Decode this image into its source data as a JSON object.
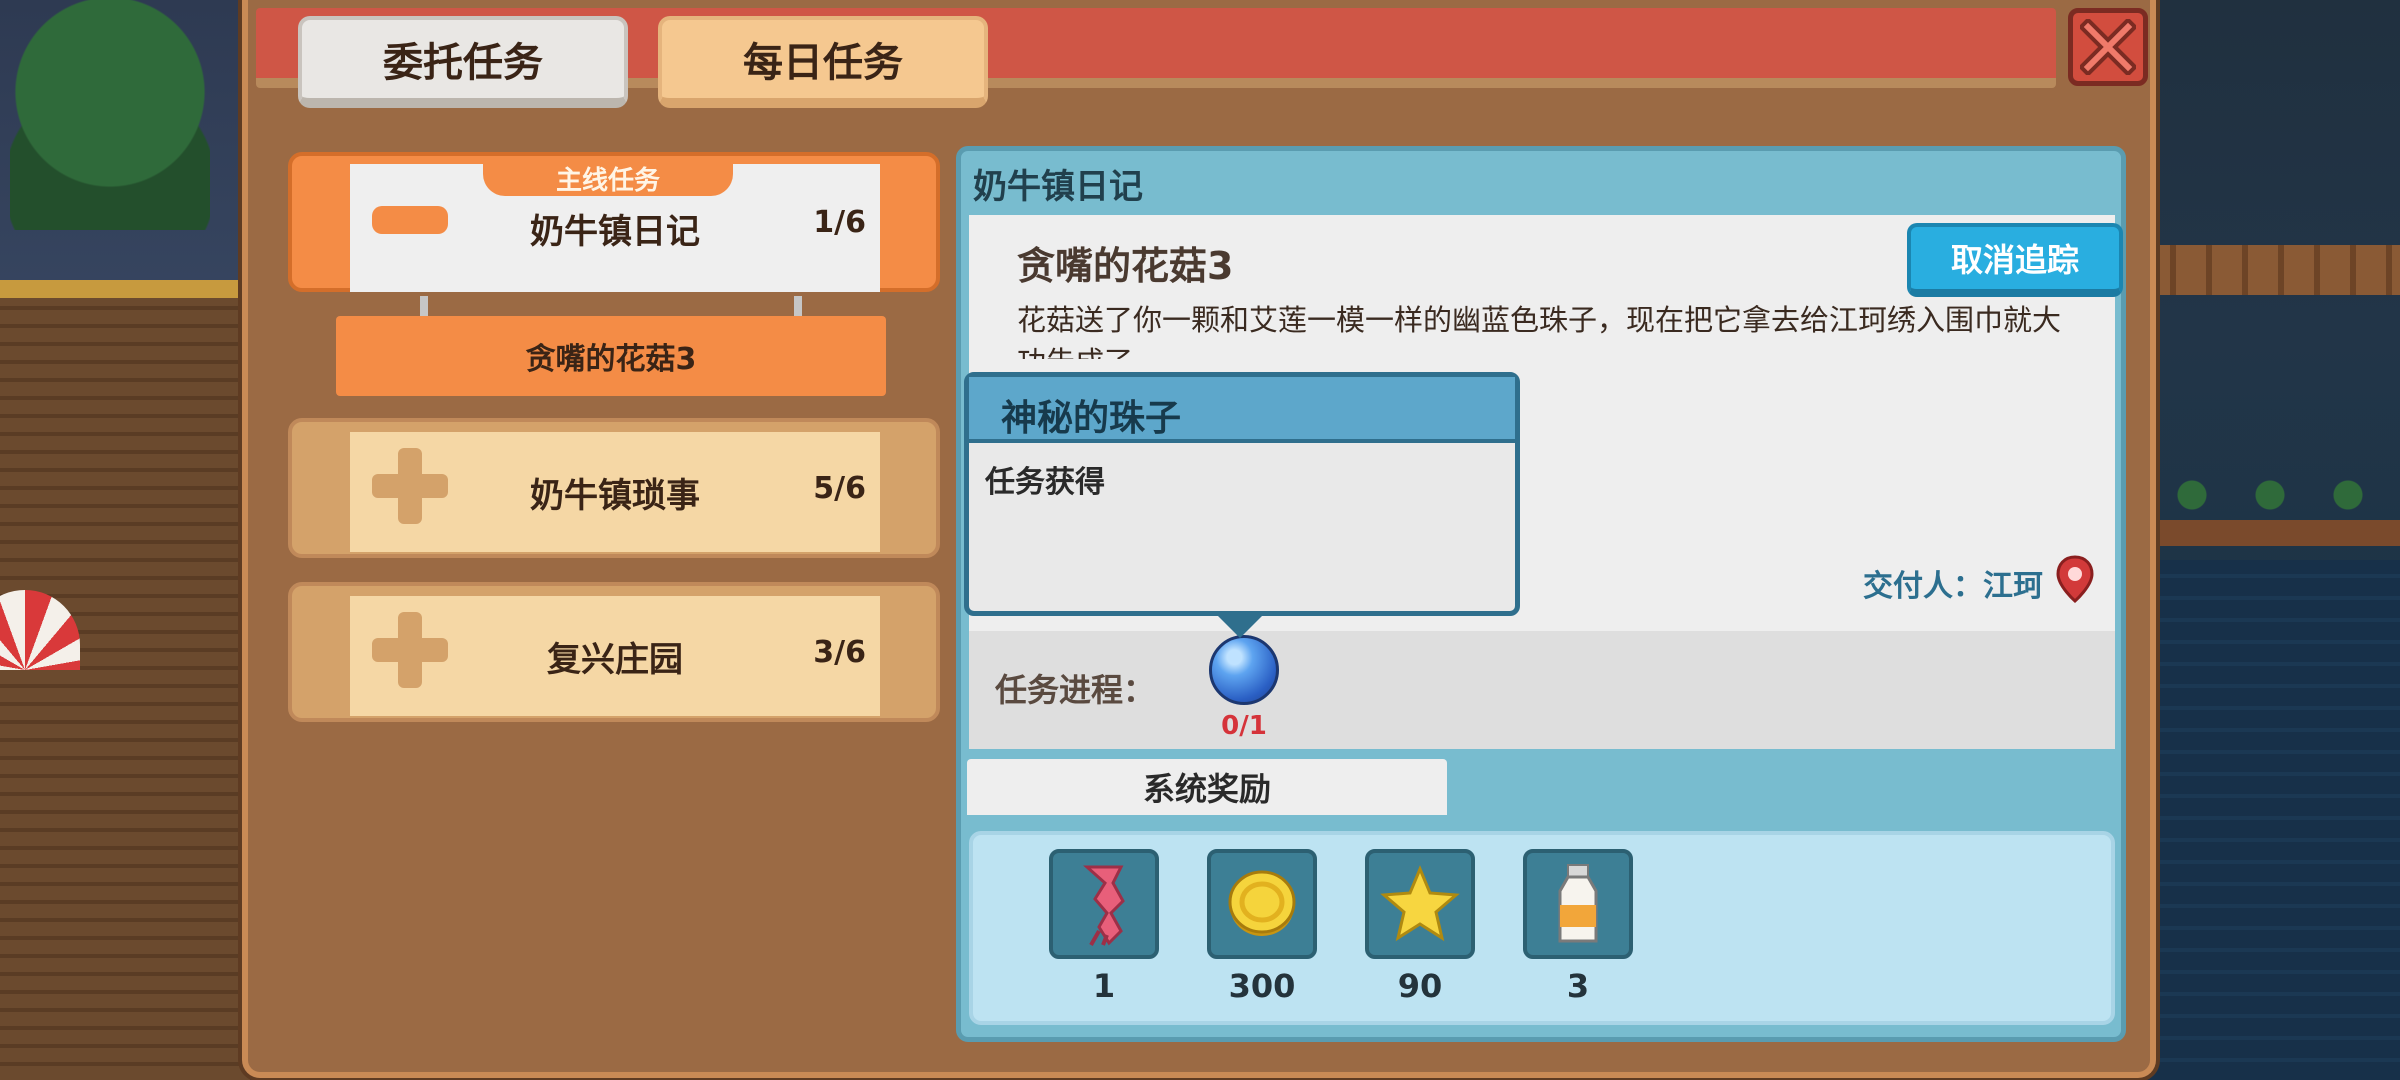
{
  "tabs": {
    "commission": "委托任务",
    "daily": "每日任务"
  },
  "quest_list": {
    "main_tag": "主线任务",
    "main": {
      "title": "奶牛镇日记",
      "progress": "1/6",
      "state": "expanded"
    },
    "sub_quest": "贪嘴的花菇3",
    "others": [
      {
        "title": "奶牛镇琐事",
        "progress": "5/6"
      },
      {
        "title": "复兴庄园",
        "progress": "3/6"
      }
    ]
  },
  "detail": {
    "header": "奶牛镇日记",
    "quest_title": "贪嘴的花菇3",
    "description": "花菇送了你一颗和艾莲一模一样的幽蓝色珠子，现在把它拿去给江珂绣入围巾就大功告成了。",
    "untrack_button": "取消追踪",
    "deliver_label": "交付人：江珂",
    "progress_label": "任务进程：",
    "progress_item": {
      "icon": "blue-orb-icon",
      "count": "0/1"
    },
    "reward_tab": "系统奖励",
    "rewards": [
      {
        "icon": "scarf-icon",
        "qty": "1"
      },
      {
        "icon": "gold-coin-icon",
        "qty": "300"
      },
      {
        "icon": "star-icon",
        "qty": "90"
      },
      {
        "icon": "milk-bottle-icon",
        "qty": "3"
      }
    ]
  },
  "tooltip": {
    "title": "神秘的珠子",
    "text": "任务获得"
  },
  "colors": {
    "panel": "#9b6a44",
    "title_bar": "#cf5646",
    "active_quest": "#f48c46",
    "detail_blue": "#78bccf",
    "button_blue": "#29aee0",
    "progress_red": "#d5333a"
  }
}
